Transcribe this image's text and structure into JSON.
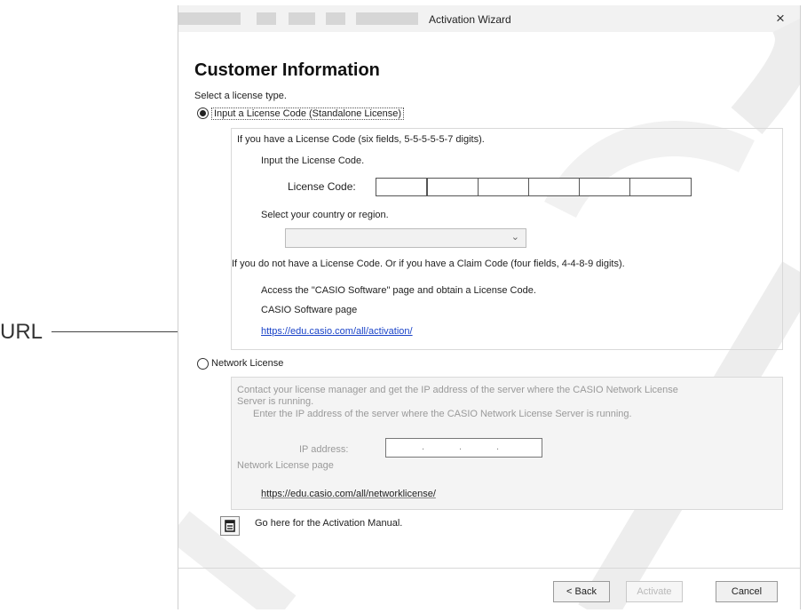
{
  "callout": {
    "label": "URL"
  },
  "window": {
    "title": "Activation Wizard",
    "close_glyph": "×"
  },
  "page": {
    "title": "Customer Information",
    "select_prompt": "Select a license type."
  },
  "standalone": {
    "option_label": "Input a License Code (Standalone License)",
    "selected": true,
    "have_code_text": "If you have a License Code (six fields, 5-5-5-5-5-7 digits).",
    "input_prompt": "Input the License Code.",
    "code_label": "License Code:",
    "code_fields": [
      "",
      "",
      "",
      "",
      "",
      ""
    ],
    "country_prompt": "Select your country or region.",
    "country_value": "",
    "no_code_text": "If you do not have a License Code. Or if you have a Claim Code (four fields, 4-4-8-9 digits).",
    "access_text": "Access the \"CASIO Software\" page and obtain a License Code.",
    "software_page_label": "CASIO Software page",
    "url": "https://edu.casio.com/all/activation/"
  },
  "network": {
    "option_label": "Network License",
    "selected": false,
    "contact_text_line1": "Contact your license manager and get the IP address of the server where the CASIO Network License",
    "contact_text_line2": "Server is running.",
    "enter_ip_text": "Enter the IP address of the server where the CASIO Network License Server is running.",
    "ip_label": "IP address:",
    "page_label": "Network License page",
    "url": "https://edu.casio.com/all/networklicense/"
  },
  "manual": {
    "link_text": "Go here for the Activation Manual."
  },
  "buttons": {
    "back": "< Back",
    "activate": "Activate",
    "cancel": "Cancel"
  },
  "icons": {
    "radio_selected": "radio-selected-icon",
    "document": "document-icon",
    "dropdown": "chevron-down-icon"
  }
}
